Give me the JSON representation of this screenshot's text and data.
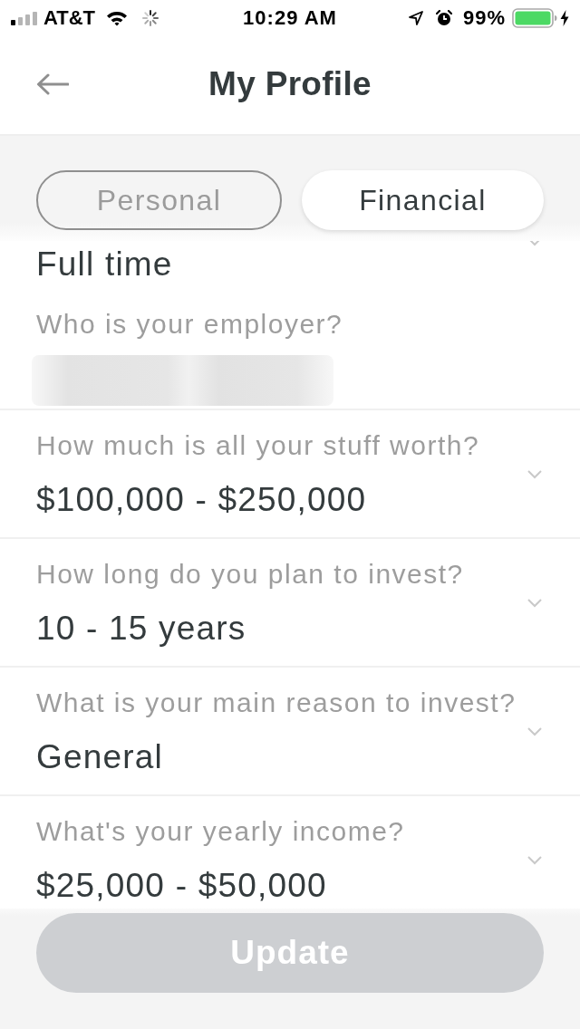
{
  "status_bar": {
    "carrier": "AT&T",
    "time": "10:29 AM",
    "battery": "99%"
  },
  "nav": {
    "title": "My Profile"
  },
  "tabs": [
    {
      "label": "Personal",
      "selected": false
    },
    {
      "label": "Financial",
      "selected": true
    }
  ],
  "groups": [
    {
      "fields": [
        {
          "kind": "select",
          "value": "Full time"
        },
        {
          "kind": "text",
          "label": "Who is your employer?",
          "redacted": true
        }
      ]
    },
    {
      "fields": [
        {
          "kind": "select",
          "label": "How much is all your stuff worth?",
          "value": "$100,000 - $250,000"
        }
      ]
    },
    {
      "fields": [
        {
          "kind": "select",
          "label": "How long do you plan to invest?",
          "value": "10 - 15 years"
        }
      ]
    },
    {
      "fields": [
        {
          "kind": "select",
          "label": "What is your main reason to invest?",
          "value": "General"
        }
      ]
    },
    {
      "fields": [
        {
          "kind": "select",
          "label": "What's your yearly income?",
          "value": "$25,000 - $50,000"
        }
      ]
    }
  ],
  "update_button": {
    "label": "Update",
    "disabled": true
  }
}
